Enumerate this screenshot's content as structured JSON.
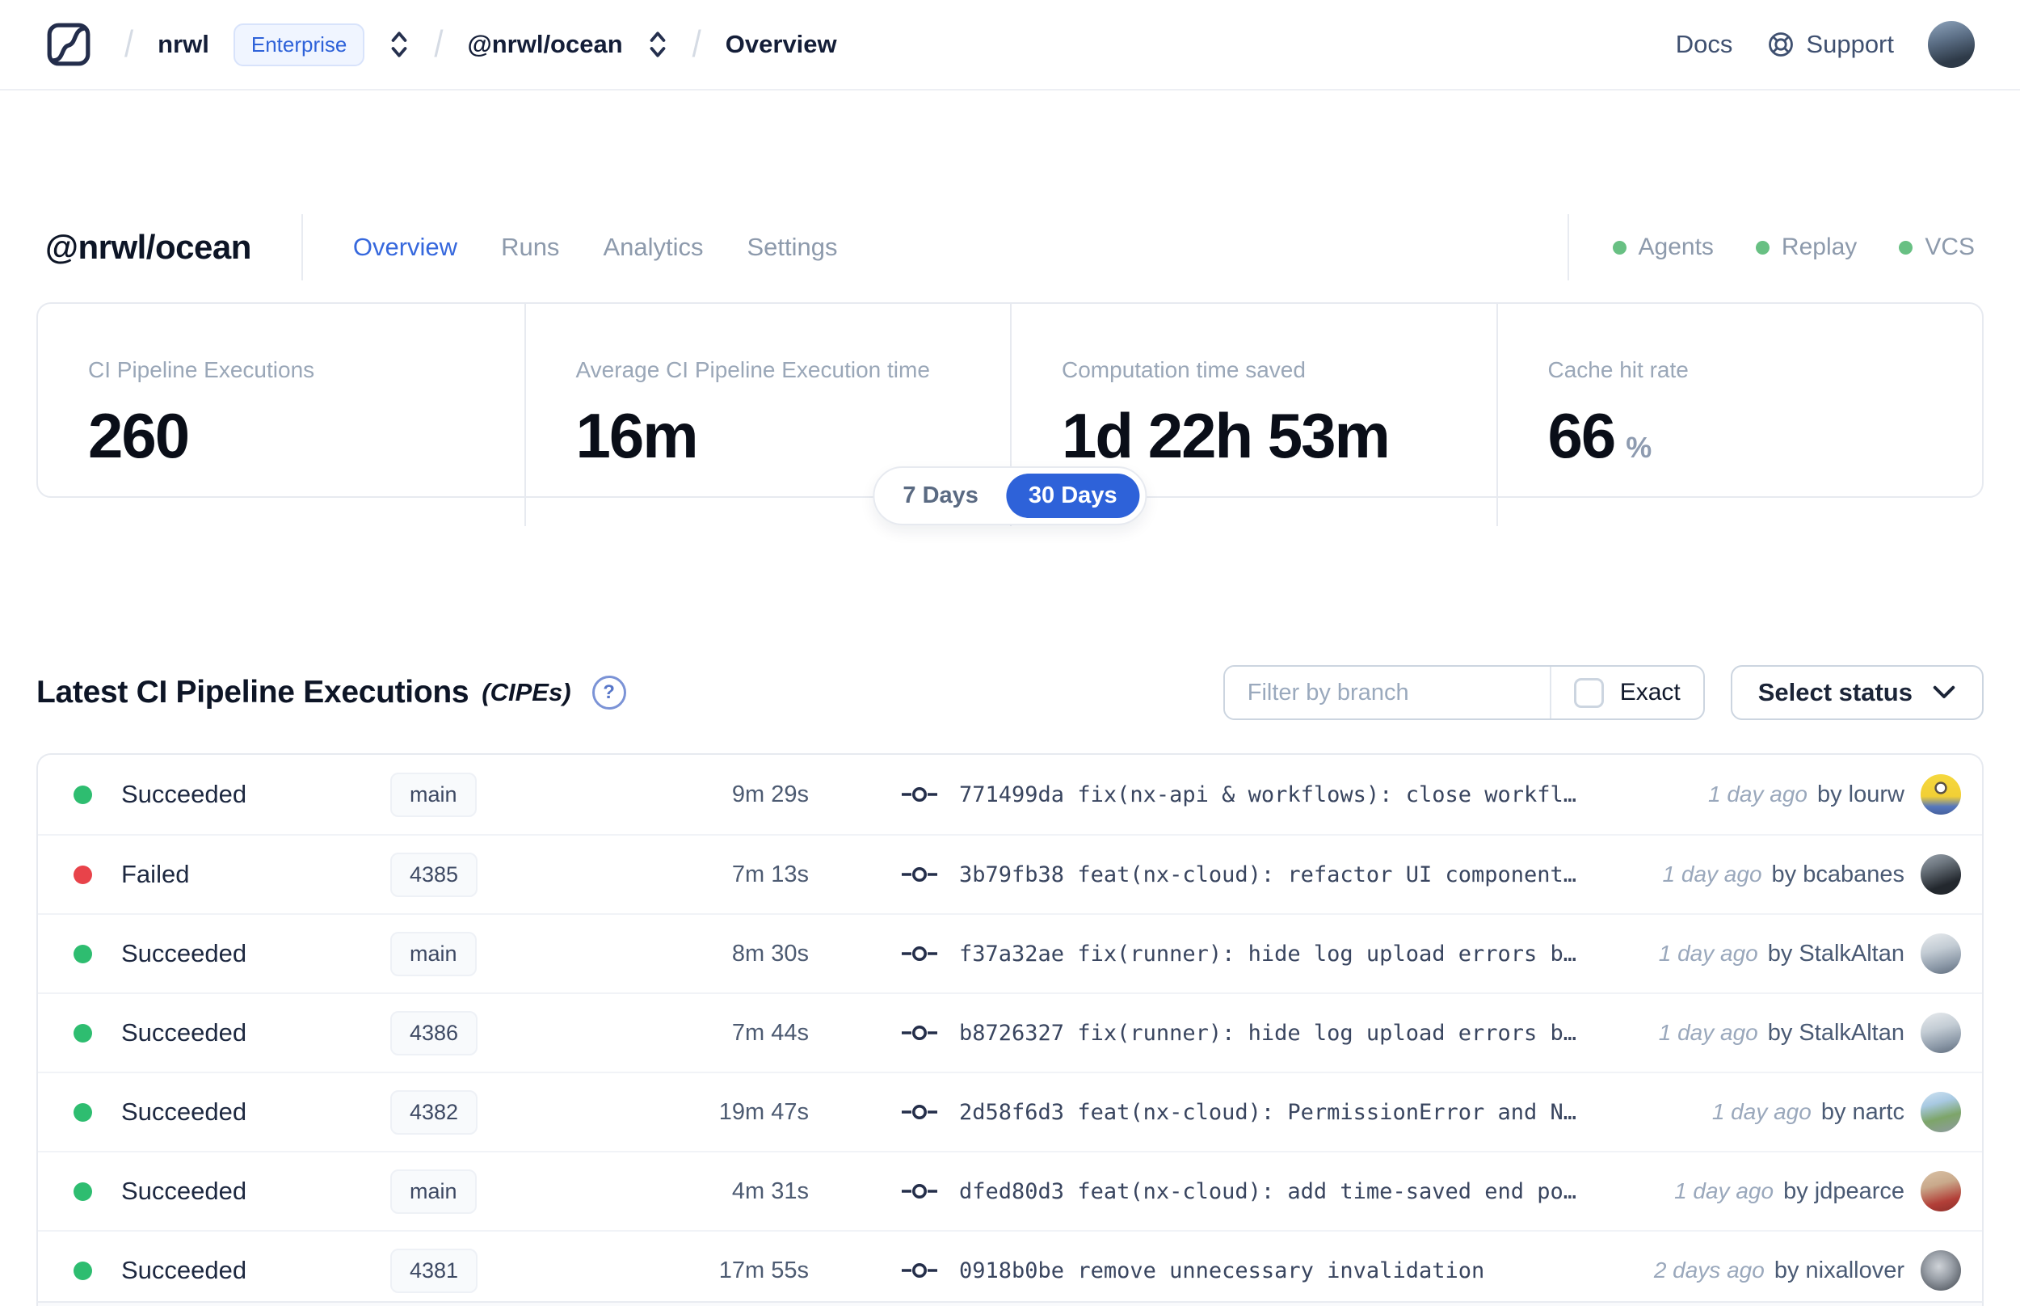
{
  "navbar": {
    "breadcrumb": {
      "separator": "/",
      "org": "nrwl",
      "org_badge": "Enterprise",
      "workspace": "@nrwl/ocean",
      "page": "Overview"
    },
    "docs": "Docs",
    "support": "Support"
  },
  "header": {
    "title": "@nrwl/ocean",
    "tabs": [
      {
        "label": "Overview",
        "active": true
      },
      {
        "label": "Runs",
        "active": false
      },
      {
        "label": "Analytics",
        "active": false
      },
      {
        "label": "Settings",
        "active": false
      }
    ],
    "services": [
      {
        "label": "Agents",
        "status_color": "#68c083"
      },
      {
        "label": "Replay",
        "status_color": "#68c083"
      },
      {
        "label": "VCS",
        "status_color": "#68c083"
      }
    ]
  },
  "stats": {
    "cards": [
      {
        "label": "CI Pipeline Executions",
        "value": "260"
      },
      {
        "label": "Average CI Pipeline Execution time",
        "value": "16m"
      },
      {
        "label": "Computation time saved",
        "value": "1d 22h 53m"
      },
      {
        "label": "Cache hit rate",
        "value": "66",
        "unit": "%"
      }
    ],
    "range_toggle": {
      "options": [
        "7 Days",
        "30 Days"
      ],
      "selected": "30 Days",
      "selected_color": "#2e62d9"
    }
  },
  "cipes": {
    "title": "Latest CI Pipeline Executions",
    "title_suffix": "(CIPEs)",
    "help_icon": "?",
    "filter": {
      "placeholder": "Filter by branch",
      "exact_label": "Exact",
      "exact_checked": false
    },
    "status_select": "Select status",
    "success_color": "#2ebd70",
    "failed_color": "#e8434a",
    "rows": [
      {
        "status": "Succeeded",
        "branch": "main",
        "duration": "9m 29s",
        "commit_hash": "771499da",
        "commit_message": "fix(nx-api & workflows): close workfl…",
        "time_ago": "1 day ago",
        "author": "by lourw"
      },
      {
        "status": "Failed",
        "branch": "4385",
        "duration": "7m 13s",
        "commit_hash": "3b79fb38",
        "commit_message": "feat(nx-cloud): refactor UI component…",
        "time_ago": "1 day ago",
        "author": "by bcabanes"
      },
      {
        "status": "Succeeded",
        "branch": "main",
        "duration": "8m 30s",
        "commit_hash": "f37a32ae",
        "commit_message": "fix(runner): hide log upload errors b…",
        "time_ago": "1 day ago",
        "author": "by StalkAltan"
      },
      {
        "status": "Succeeded",
        "branch": "4386",
        "duration": "7m 44s",
        "commit_hash": "b8726327",
        "commit_message": "fix(runner): hide log upload errors b…",
        "time_ago": "1 day ago",
        "author": "by StalkAltan"
      },
      {
        "status": "Succeeded",
        "branch": "4382",
        "duration": "19m 47s",
        "commit_hash": "2d58f6d3",
        "commit_message": "feat(nx-cloud): PermissionError and N…",
        "time_ago": "1 day ago",
        "author": "by nartc"
      },
      {
        "status": "Succeeded",
        "branch": "main",
        "duration": "4m 31s",
        "commit_hash": "dfed80d3",
        "commit_message": "feat(nx-cloud): add time-saved end po…",
        "time_ago": "1 day ago",
        "author": "by jdpearce"
      },
      {
        "status": "Succeeded",
        "branch": "4381",
        "duration": "17m 55s",
        "commit_hash": "0918b0be",
        "commit_message": "remove unnecessary invalidation",
        "time_ago": "2 days ago",
        "author": "by nixallover"
      }
    ]
  }
}
